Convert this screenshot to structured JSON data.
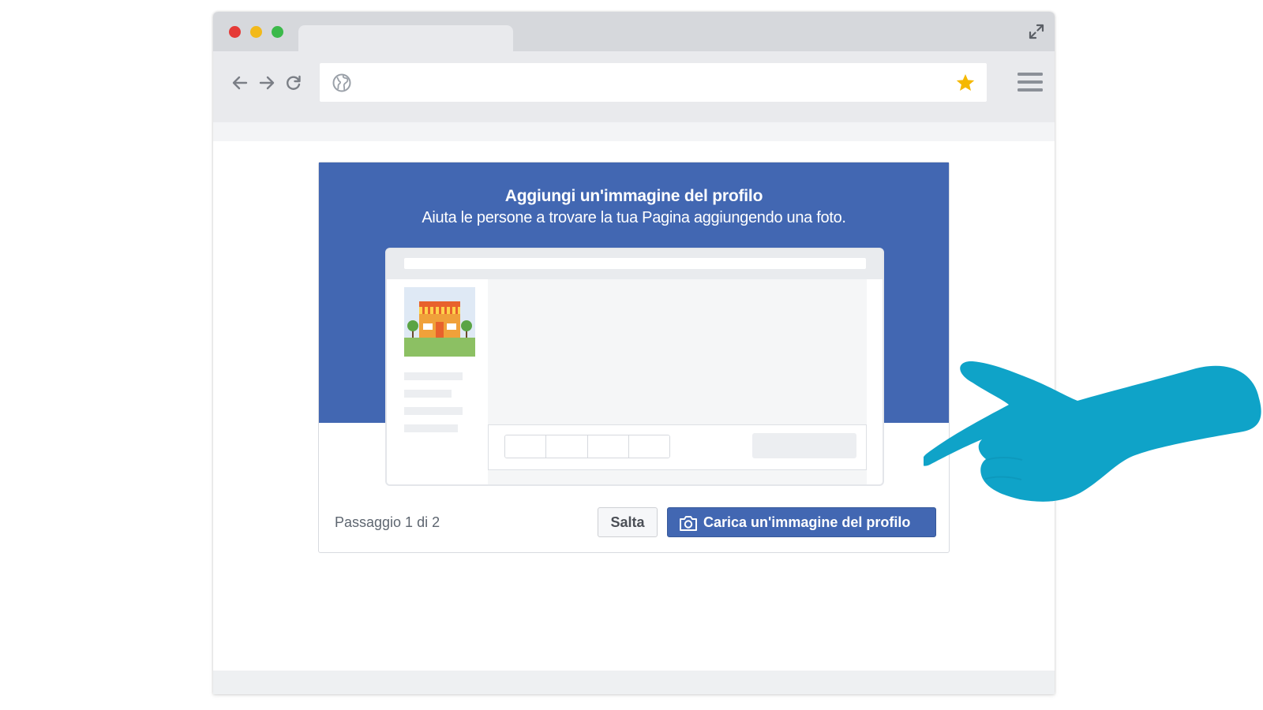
{
  "browser": {
    "icons": {
      "expand": "expand-arrows-icon",
      "back": "arrow-left-icon",
      "forward": "arrow-right-icon",
      "reload": "reload-icon",
      "globe": "globe-icon",
      "bookmark": "star-icon",
      "menu": "hamburger-menu-icon"
    },
    "colors": {
      "close": "#e53a37",
      "minimize": "#f2b91a",
      "maximize": "#3bb94a",
      "bookmark": "#f5b800"
    }
  },
  "dialog": {
    "title": "Aggiungi un'immagine del profilo",
    "subtitle": "Aiuta le persone a trovare la tua Pagina aggiungendo una foto.",
    "step": "Passaggio 1 di 2",
    "skip_label": "Salta",
    "upload_label": "Carica un'immagine del profilo",
    "upload_icon": "camera-icon",
    "accent_color": "#4267b2"
  },
  "overlay": {
    "pointer": "pointing-hand-icon",
    "color": "#0fa3c8"
  }
}
